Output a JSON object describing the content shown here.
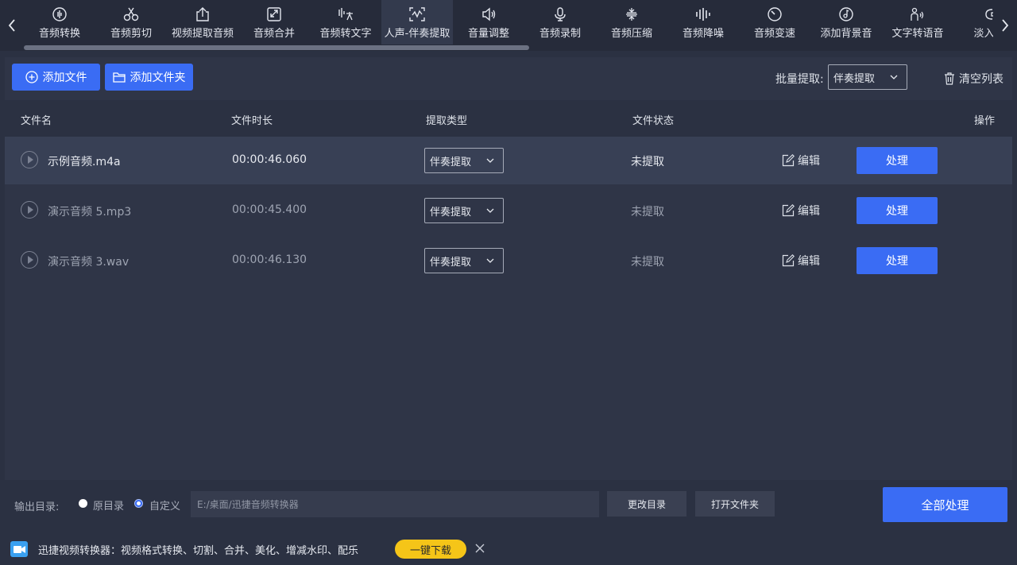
{
  "toolbar": {
    "tools": [
      {
        "label": "音频转换",
        "icon": "waveform-icon"
      },
      {
        "label": "音频剪切",
        "icon": "scissors-icon"
      },
      {
        "label": "视频提取音频",
        "icon": "upload-icon"
      },
      {
        "label": "音频合并",
        "icon": "merge-icon"
      },
      {
        "label": "音频转文字",
        "icon": "translate-icon"
      },
      {
        "label": "人声-伴奏提取",
        "icon": "voice-extract-icon"
      },
      {
        "label": "音量调整",
        "icon": "speaker-icon"
      },
      {
        "label": "音频录制",
        "icon": "microphone-icon"
      },
      {
        "label": "音频压缩",
        "icon": "compress-icon"
      },
      {
        "label": "音频降噪",
        "icon": "equalizer-icon"
      },
      {
        "label": "音频变速",
        "icon": "speed-icon"
      },
      {
        "label": "添加背景音",
        "icon": "music-disc-icon"
      },
      {
        "label": "文字转语音",
        "icon": "tts-icon"
      },
      {
        "label": "淡入淡",
        "icon": "fade-icon"
      }
    ],
    "active_index": 5
  },
  "actions": {
    "add_file": "添加文件",
    "add_folder": "添加文件夹",
    "batch_label": "批量提取:",
    "batch_value": "伴奏提取",
    "clear_list": "清空列表"
  },
  "table": {
    "headers": {
      "name": "文件名",
      "duration": "文件时长",
      "type": "提取类型",
      "status": "文件状态",
      "operation": "操作"
    },
    "rows": [
      {
        "name": "示例音频.m4a",
        "duration": "00:00:46.060",
        "type": "伴奏提取",
        "status": "未提取",
        "edit": "编辑",
        "process": "处理"
      },
      {
        "name": "演示音频 5.mp3",
        "duration": "00:00:45.400",
        "type": "伴奏提取",
        "status": "未提取",
        "edit": "编辑",
        "process": "处理"
      },
      {
        "name": "演示音频 3.wav",
        "duration": "00:00:46.130",
        "type": "伴奏提取",
        "status": "未提取",
        "edit": "编辑",
        "process": "处理"
      }
    ]
  },
  "output": {
    "label": "输出目录:",
    "option_original": "原目录",
    "option_custom": "自定义",
    "path": "E:/桌面/迅捷音频转换器",
    "change_dir": "更改目录",
    "open_folder": "打开文件夹",
    "process_all": "全部处理"
  },
  "ad": {
    "text": "迅捷视频转换器：视频格式转换、切割、合并、美化、增减水印、配乐",
    "download": "一键下载"
  },
  "colors": {
    "accent": "#3a6cf4",
    "background": "#2b3142",
    "download_button": "#f5c518"
  }
}
